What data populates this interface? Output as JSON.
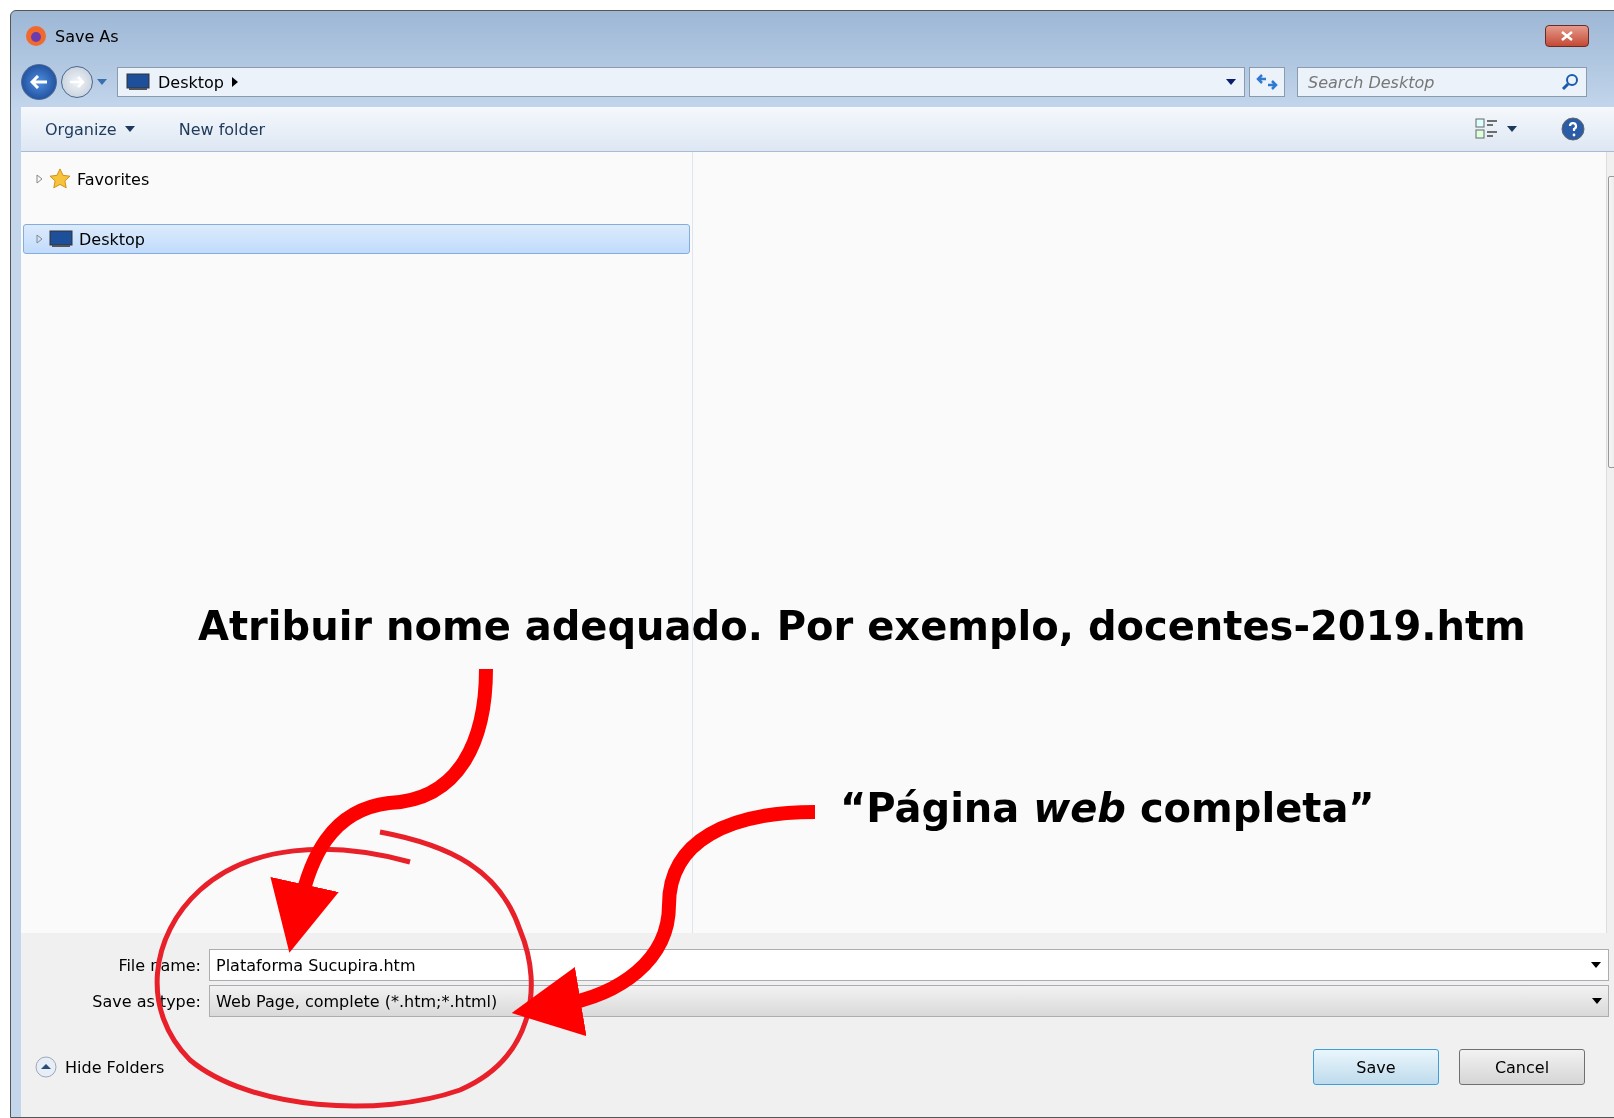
{
  "window": {
    "title": "Save As"
  },
  "address_bar": {
    "path": "Desktop"
  },
  "search": {
    "placeholder": "Search Desktop"
  },
  "toolbar": {
    "buttons": [
      {
        "label": "Organize",
        "dropdown": true
      },
      {
        "label": "New folder",
        "dropdown": false
      }
    ]
  },
  "tree": [
    {
      "label": "Favorites",
      "kind": "star",
      "selected": false
    },
    {
      "label": "Desktop",
      "kind": "monitor",
      "selected": true
    }
  ],
  "form": {
    "file_name_label": "File name:",
    "file_name": "Plataforma Sucupira.htm",
    "type_label": "Save as type:",
    "type": "Web Page, complete (*.htm;*.html)"
  },
  "hide_folders": "Hide Folders",
  "buttons": [
    {
      "label": "Save",
      "default": true
    },
    {
      "label": "Cancel",
      "default": false
    }
  ],
  "annotations": [
    "Atribuir nome adequado. Por exemplo, docentes-2019.htm",
    "“Página *web* completa”"
  ]
}
